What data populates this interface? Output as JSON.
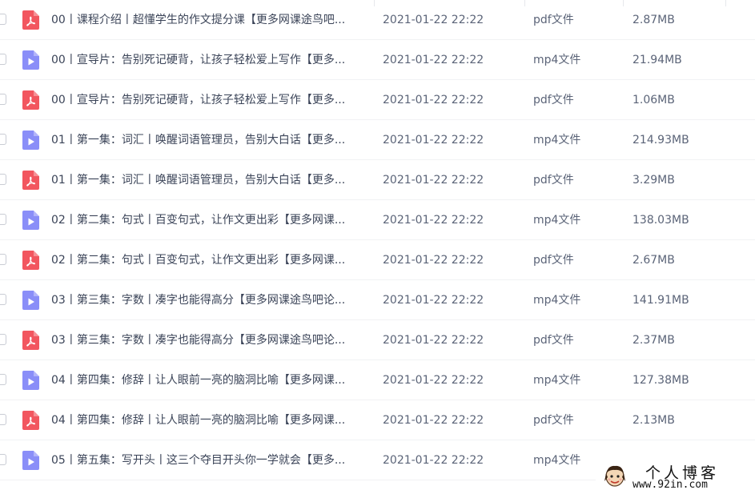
{
  "colors": {
    "pdf_icon": "#f2565f",
    "mp4_icon": "#8a8ef8"
  },
  "files": [
    {
      "name": "00丨课程介绍丨超懂学生的作文提分课【更多网课途鸟吧...",
      "date": "2021-01-22 22:22",
      "type": "pdf文件",
      "size": "2.87MB",
      "icon": "pdf-icon"
    },
    {
      "name": "00丨宣导片：告别死记硬背，让孩子轻松爱上写作【更多...",
      "date": "2021-01-22 22:22",
      "type": "mp4文件",
      "size": "21.94MB",
      "icon": "video-icon"
    },
    {
      "name": "00丨宣导片：告别死记硬背，让孩子轻松爱上写作【更多...",
      "date": "2021-01-22 22:22",
      "type": "pdf文件",
      "size": "1.06MB",
      "icon": "pdf-icon"
    },
    {
      "name": "01丨第一集：词汇丨唤醒词语管理员，告别大白话【更多...",
      "date": "2021-01-22 22:22",
      "type": "mp4文件",
      "size": "214.93MB",
      "icon": "video-icon"
    },
    {
      "name": "01丨第一集：词汇丨唤醒词语管理员，告别大白话【更多...",
      "date": "2021-01-22 22:22",
      "type": "pdf文件",
      "size": "3.29MB",
      "icon": "pdf-icon"
    },
    {
      "name": "02丨第二集：句式丨百变句式，让作文更出彩【更多网课...",
      "date": "2021-01-22 22:22",
      "type": "mp4文件",
      "size": "138.03MB",
      "icon": "video-icon"
    },
    {
      "name": "02丨第二集：句式丨百变句式，让作文更出彩【更多网课...",
      "date": "2021-01-22 22:22",
      "type": "pdf文件",
      "size": "2.67MB",
      "icon": "pdf-icon"
    },
    {
      "name": "03丨第三集：字数丨凑字也能得高分【更多网课途鸟吧论...",
      "date": "2021-01-22 22:22",
      "type": "mp4文件",
      "size": "141.91MB",
      "icon": "video-icon"
    },
    {
      "name": "03丨第三集：字数丨凑字也能得高分【更多网课途鸟吧论...",
      "date": "2021-01-22 22:22",
      "type": "pdf文件",
      "size": "2.37MB",
      "icon": "pdf-icon"
    },
    {
      "name": "04丨第四集：修辞丨让人眼前一亮的脑洞比喻【更多网课...",
      "date": "2021-01-22 22:22",
      "type": "mp4文件",
      "size": "127.38MB",
      "icon": "video-icon"
    },
    {
      "name": "04丨第四集：修辞丨让人眼前一亮的脑洞比喻【更多网课...",
      "date": "2021-01-22 22:22",
      "type": "pdf文件",
      "size": "2.13MB",
      "icon": "pdf-icon"
    },
    {
      "name": "05丨第五集：写开头丨这三个夺目开头你一学就会【更多...",
      "date": "2021-01-22 22:22",
      "type": "mp4文件",
      "size": "",
      "icon": "video-icon"
    }
  ],
  "watermark": {
    "title": "个人博客",
    "url": "www.92in.com"
  }
}
